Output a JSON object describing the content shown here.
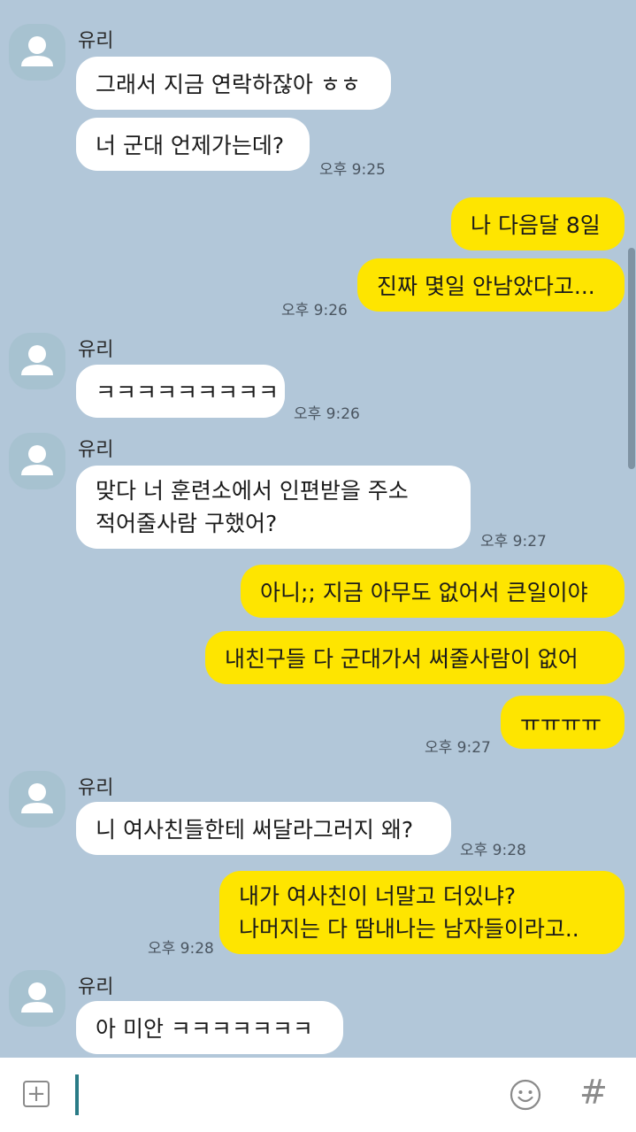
{
  "chat": {
    "contact_name": "유리",
    "messages": [
      {
        "text": "그래서 지금 연락하잖아 ㅎㅎ"
      },
      {
        "text": "너 군대 언제가는데?",
        "time": "오후 9:25"
      },
      {
        "text": "나 다음달 8일"
      },
      {
        "text": "진짜 몇일 안남았다고...",
        "time": "오후 9:26"
      },
      {
        "text": "ㅋㅋㅋㅋㅋㅋㅋㅋㅋ",
        "time": "오후 9:26"
      },
      {
        "line1": "맞다 너 훈련소에서 인편받을 주소",
        "line2": "적어줄사람 구했어?",
        "time": "오후 9:27"
      },
      {
        "text": "아니;; 지금 아무도 없어서 큰일이야"
      },
      {
        "text": "내친구들 다 군대가서 써줄사람이 없어"
      },
      {
        "text": "ㅠㅠㅠㅠ",
        "time": "오후 9:27"
      },
      {
        "text": "니 여사친들한테 써달라그러지 왜?",
        "time": "오후 9:28"
      },
      {
        "line1": "내가 여사친이 너말고 더있냐?",
        "line2": "나머지는 다 땀내나는 남자들이라고..",
        "time": "오후 9:28"
      },
      {
        "text": "아 미안 ㅋㅋㅋㅋㅋㅋㅋ"
      }
    ]
  },
  "input": {
    "plus_icon": "plus-square-icon",
    "emoji_icon": "smiley-icon",
    "hash_symbol": "#"
  },
  "colors": {
    "background": "#b2c7d9",
    "incoming_bubble": "#ffffff",
    "outgoing_bubble": "#fee500",
    "cursor": "#2a7b86"
  }
}
